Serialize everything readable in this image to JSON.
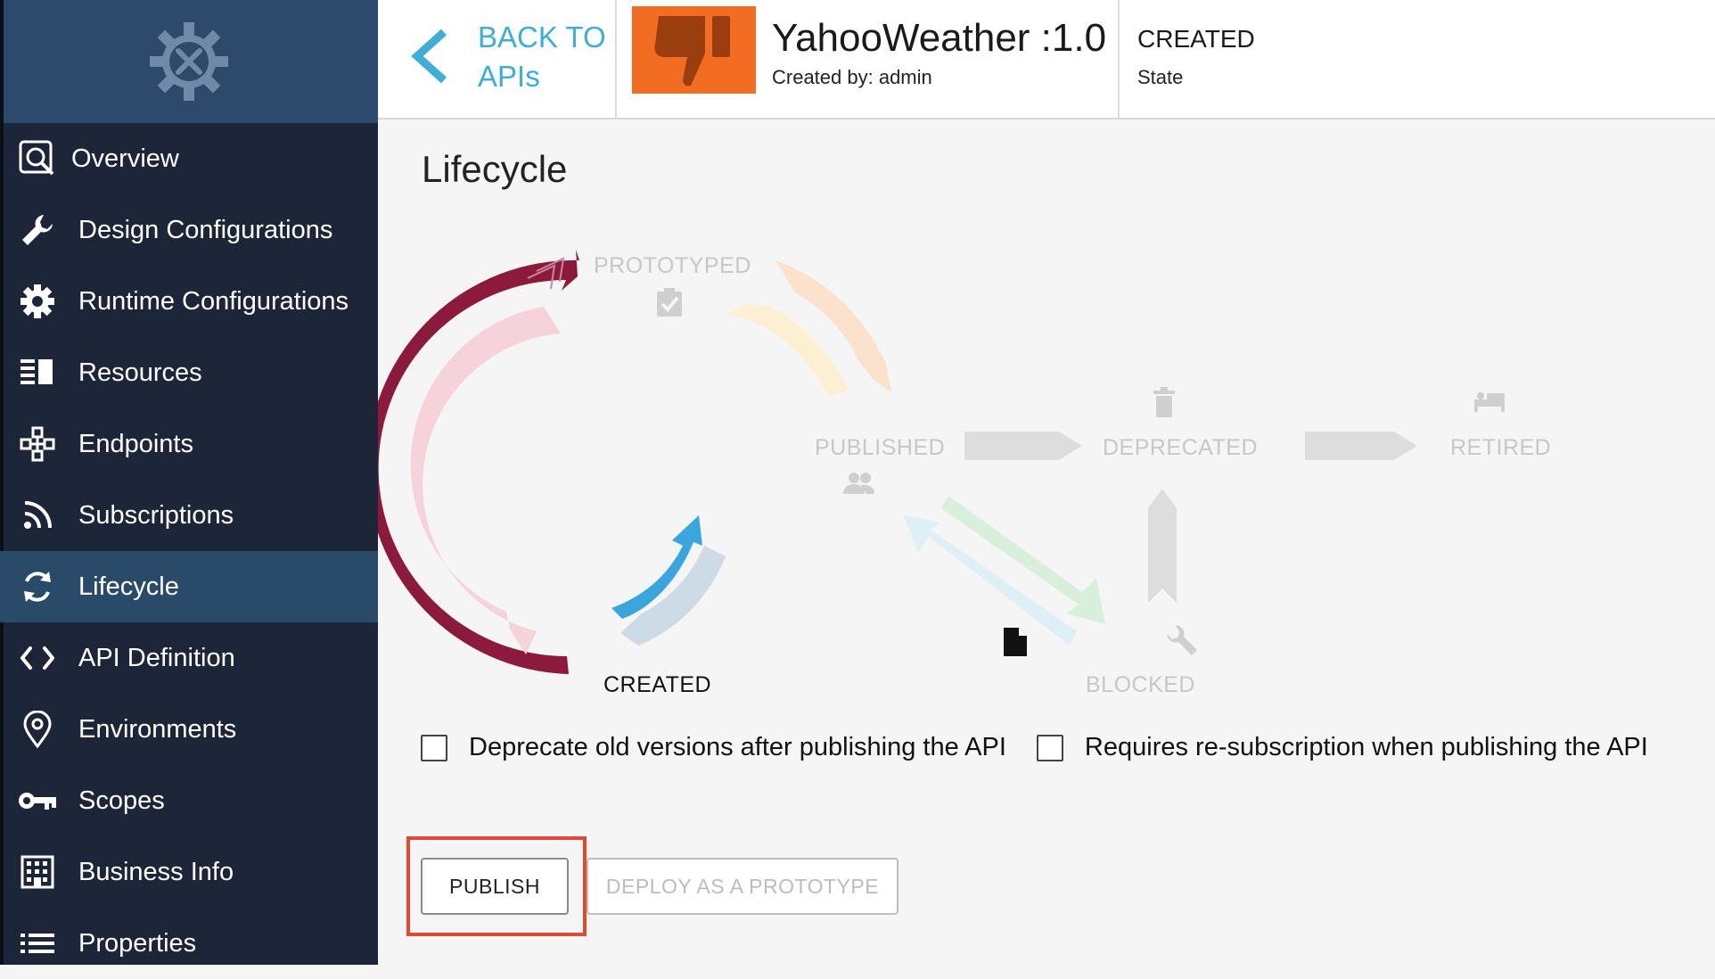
{
  "sidebar": {
    "items": [
      {
        "label": "Overview",
        "icon": "overview-icon"
      },
      {
        "label": "Design Configurations",
        "icon": "wrench-icon"
      },
      {
        "label": "Runtime Configurations",
        "icon": "gear-icon"
      },
      {
        "label": "Resources",
        "icon": "resources-icon"
      },
      {
        "label": "Endpoints",
        "icon": "endpoints-icon"
      },
      {
        "label": "Subscriptions",
        "icon": "rss-icon"
      },
      {
        "label": "Lifecycle",
        "icon": "refresh-icon",
        "active": true
      },
      {
        "label": "API Definition",
        "icon": "code-icon"
      },
      {
        "label": "Environments",
        "icon": "location-pin-icon"
      },
      {
        "label": "Scopes",
        "icon": "key-icon"
      },
      {
        "label": "Business Info",
        "icon": "building-icon"
      },
      {
        "label": "Properties",
        "icon": "list-icon"
      }
    ]
  },
  "header": {
    "back_line1": "BACK TO",
    "back_line2": "APIs",
    "api_title": "YahooWeather :1.0",
    "created_by": "Created by: admin",
    "state_value": "CREATED",
    "state_label": "State"
  },
  "page": {
    "title": "Lifecycle"
  },
  "lifecycle": {
    "states": {
      "prototyped": "PROTOTYPED",
      "published": "PUBLISHED",
      "deprecated": "DEPRECATED",
      "retired": "RETIRED",
      "created": "CREATED",
      "blocked": "BLOCKED"
    },
    "current_state": "CREATED"
  },
  "options": {
    "deprecate_old": {
      "label": "Deprecate old versions after publishing the API",
      "checked": false
    },
    "require_resubscription": {
      "label": "Requires re-subscription when publishing the API",
      "checked": false
    }
  },
  "actions": {
    "publish": "PUBLISH",
    "deploy_prototype": "DEPLOY AS A PROTOTYPE"
  },
  "colors": {
    "sidebar_bg": "#1d2538",
    "sidebar_active": "#2a4a6a",
    "logo_bg": "#2d4a6c",
    "accent": "#3eaed6",
    "thumb": "#f26c22",
    "highlight": "#e04933",
    "arrow_created_prototyped": "#8c1a3c",
    "arrow_created_published": "#3ba6dd"
  }
}
